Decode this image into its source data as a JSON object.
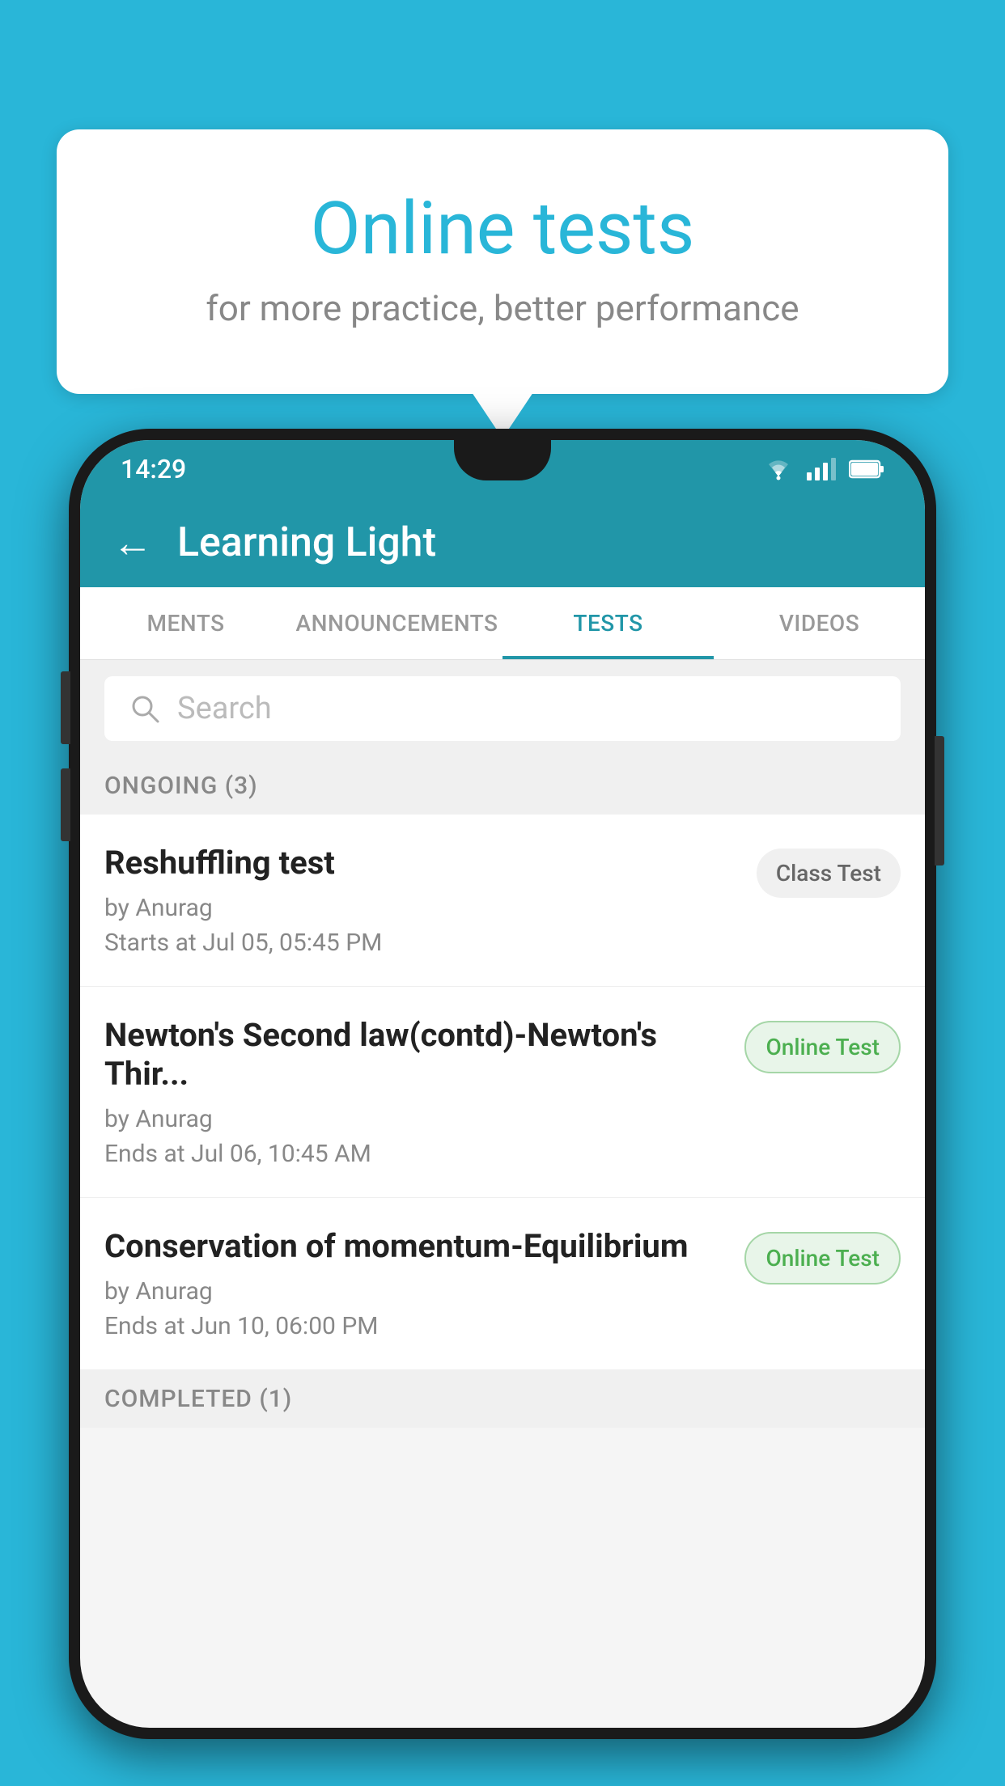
{
  "background_color": "#29b6d8",
  "speech_bubble": {
    "title": "Online tests",
    "subtitle": "for more practice, better performance"
  },
  "status_bar": {
    "time": "14:29",
    "wifi": "▼",
    "signal": "▲",
    "battery": "■"
  },
  "app_bar": {
    "title": "Learning Light",
    "back_label": "←"
  },
  "tabs": [
    {
      "label": "MENTS",
      "active": false
    },
    {
      "label": "ANNOUNCEMENTS",
      "active": false
    },
    {
      "label": "TESTS",
      "active": true
    },
    {
      "label": "VIDEOS",
      "active": false
    }
  ],
  "search": {
    "placeholder": "Search"
  },
  "ongoing_section": {
    "title": "ONGOING (3)",
    "tests": [
      {
        "name": "Reshuffling test",
        "author": "by Anurag",
        "date": "Starts at  Jul 05, 05:45 PM",
        "badge": "Class Test",
        "badge_type": "class"
      },
      {
        "name": "Newton's Second law(contd)-Newton's Thir...",
        "author": "by Anurag",
        "date": "Ends at  Jul 06, 10:45 AM",
        "badge": "Online Test",
        "badge_type": "online"
      },
      {
        "name": "Conservation of momentum-Equilibrium",
        "author": "by Anurag",
        "date": "Ends at  Jun 10, 06:00 PM",
        "badge": "Online Test",
        "badge_type": "online"
      }
    ]
  },
  "completed_section": {
    "title": "COMPLETED (1)"
  }
}
